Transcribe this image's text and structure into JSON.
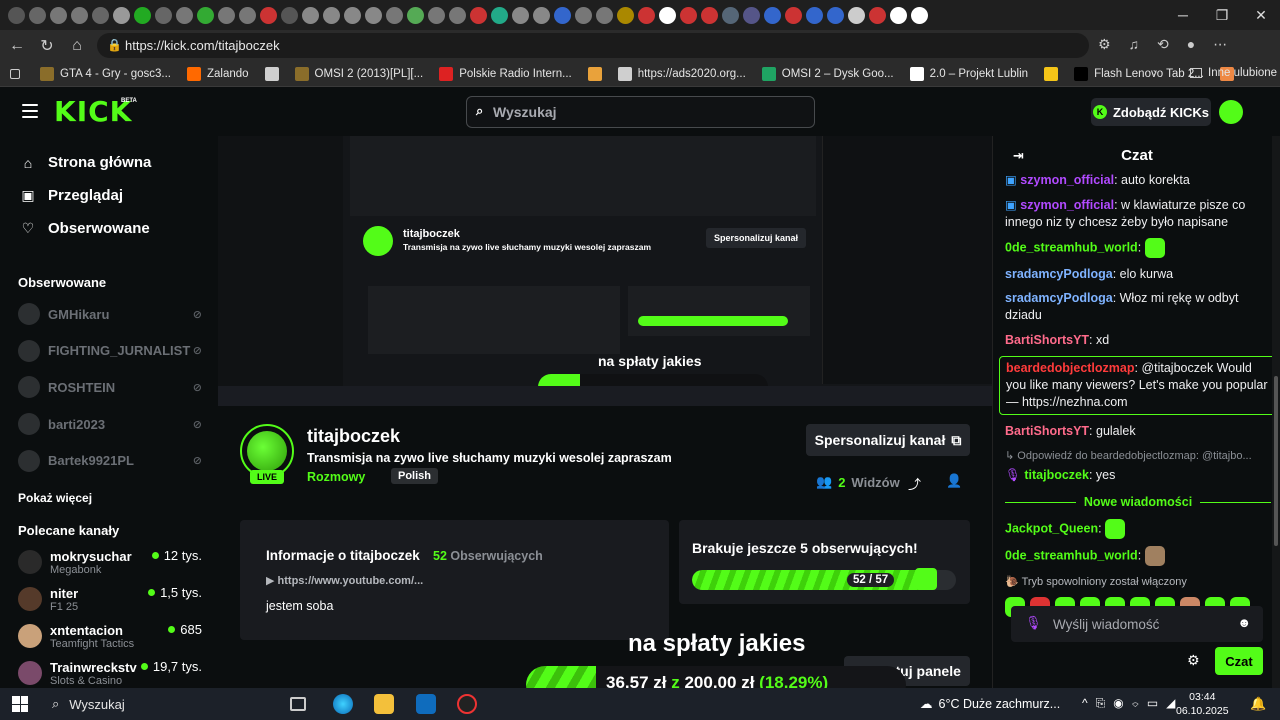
{
  "browser": {
    "url": "https://kick.com/titajboczek",
    "bookmarks": [
      {
        "label": "GTA 4 - Gry - gosc3...",
        "color": "#8a6d2a"
      },
      {
        "label": "Zalando",
        "color": "#ff6900"
      },
      {
        "label": "",
        "color": "#cfcfcf"
      },
      {
        "label": "OMSI 2 (2013)[PL][...",
        "color": "#8a6d2a"
      },
      {
        "label": "Polskie Radio Intern...",
        "color": "#d22"
      },
      {
        "label": "",
        "color": "#e9a23b"
      },
      {
        "label": "https://ads2020.org...",
        "color": "#cfcfcf"
      },
      {
        "label": "OMSI 2 – Dysk Goo...",
        "color": "#1fa463"
      },
      {
        "label": "2.0 – Projekt Lublin",
        "color": "#ffffff"
      },
      {
        "label": "",
        "color": "#f5c518"
      },
      {
        "label": "Flash Lenovo Tab 2...",
        "color": "#000000"
      },
      {
        "label": "",
        "color": "#e84"
      }
    ],
    "other_bookmarks": "Inne ulubione"
  },
  "header": {
    "logo": "KICK",
    "beta": "BETA",
    "search_placeholder": "Wyszukaj",
    "kicks_button": "Zdobądź KICKs"
  },
  "sidebar": {
    "nav": [
      {
        "label": "Strona główna",
        "icon": "home-icon"
      },
      {
        "label": "Przeglądaj",
        "icon": "browse-icon"
      },
      {
        "label": "Obserwowane",
        "icon": "heart-icon"
      }
    ],
    "followed_heading": "Obserwowane",
    "followed": [
      "GMHikaru",
      "FIGHTING_JURNALIST",
      "ROSHTEIN",
      "barti2023",
      "Bartek9921PL"
    ],
    "show_more": "Pokaż więcej",
    "recommended_heading": "Polecane kanały",
    "recommended": [
      {
        "name": "mokrysuchar",
        "category": "Megabonk",
        "viewers": "12 tys."
      },
      {
        "name": "niter",
        "category": "F1 25",
        "viewers": "1,5 tys."
      },
      {
        "name": "xntentacion",
        "category": "Teamfight Tactics",
        "viewers": "685"
      },
      {
        "name": "Trainwreckstv",
        "category": "Slots & Casino",
        "viewers": "19,7 tys."
      }
    ]
  },
  "channel": {
    "live_badge": "LIVE",
    "name": "titajboczek",
    "stream_title": "Transmisja na zywo live słuchamy muzyki wesolej zapraszam",
    "category": "Rozmowy",
    "language": "Polish",
    "personalize_button": "Spersonalizuj kanał",
    "watchers_count": "2",
    "watchers_label": "Widzów",
    "about_heading": "Informacje o titajboczek",
    "followers_count": "52",
    "followers_label": "Obserwujących",
    "link": "https://www.youtube.com/...",
    "description": "jestem soba",
    "goal_heading": "Brakuje jeszcze 5 obserwujących!",
    "goal_progress_text": "52 / 57",
    "goal_fraction": 0.912,
    "overlay_title": "na spłaty jakies",
    "edit_panels": "Edytuj panele",
    "donation_current": "36,57 zł",
    "donation_z": "z",
    "donation_target": "200,00 zł",
    "donation_percent": "(18.29%)"
  },
  "chat": {
    "title": "Czat",
    "messages": [
      {
        "user": "szymon_official",
        "color": "#b14aff",
        "text": ": auto korekta"
      },
      {
        "user": "szymon_official",
        "color": "#b14aff",
        "text": ": w klawiaturze pisze co innego niz ty chcesz żeby było napisane"
      },
      {
        "user": "0de_streamhub_world",
        "color": "#53fc18",
        "text": ":"
      },
      {
        "user": "sradamcyPodloga",
        "color": "#7fb3ff",
        "text": ": elo kurwa"
      },
      {
        "user": "sradamcyPodloga",
        "color": "#7fb3ff",
        "text": ": Włoz mi rękę w odbyt dziadu"
      },
      {
        "user": "BartiShortsYT",
        "color": "#ff6b8b",
        "text": ": xd"
      }
    ],
    "highlight": {
      "user": "beardedobjectlozmap",
      "text": ": @titajboczek Would you like many viewers? Let's make you popular — https://nezhna.com"
    },
    "after_highlight": {
      "user": "BartiShortsYT",
      "text": ": gulalek"
    },
    "reply_to": "Odpowiedź do beardedobjectlozmap: @titajbo...",
    "reply": {
      "user": "titajboczek",
      "text": ": yes"
    },
    "new_messages": "Nowe wiadomości",
    "new": [
      {
        "user": "Jackpot_Queen",
        "text": ":"
      },
      {
        "user": "0de_streamhub_world",
        "text": ":"
      }
    ],
    "slow_mode": "Tryb spowolniony został włączony",
    "input_placeholder": "Wyślij wiadomość",
    "send_button": "Czat"
  },
  "taskbar": {
    "search": "Wyszukaj",
    "weather": "6°C  Duże zachmurz...",
    "time": "03:44",
    "date": "06.10.2025"
  }
}
